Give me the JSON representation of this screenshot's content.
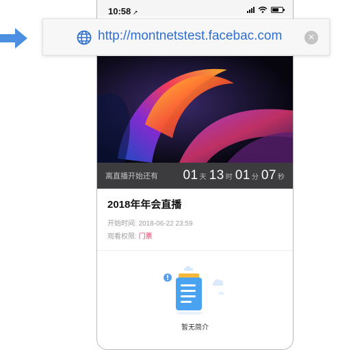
{
  "statusbar": {
    "time": "10:58",
    "time_icon": "location-arrow-icon"
  },
  "browser": {
    "url": "http://montnetstest.facebac.com",
    "url_icon": "globe-icon",
    "clear_icon": "clear-icon"
  },
  "countdown": {
    "label": "离直播开始还有",
    "days": "01",
    "days_unit": "天",
    "hours": "13",
    "hours_unit": "时",
    "minutes": "01",
    "minutes_unit": "分",
    "seconds": "07",
    "seconds_unit": "秒"
  },
  "event": {
    "title": "2018年年会直播",
    "start_label": "开始时间:",
    "start_value": "2018-06-22 23:59",
    "access_label": "观看权限:",
    "access_value": "门票"
  },
  "empty": {
    "text": "暂无简介"
  },
  "colors": {
    "accent_link": "#2f6fcf",
    "ticket": "#e83e6e",
    "arrow": "#4a8fe2",
    "countdown_bg": "#3c3c3e"
  }
}
